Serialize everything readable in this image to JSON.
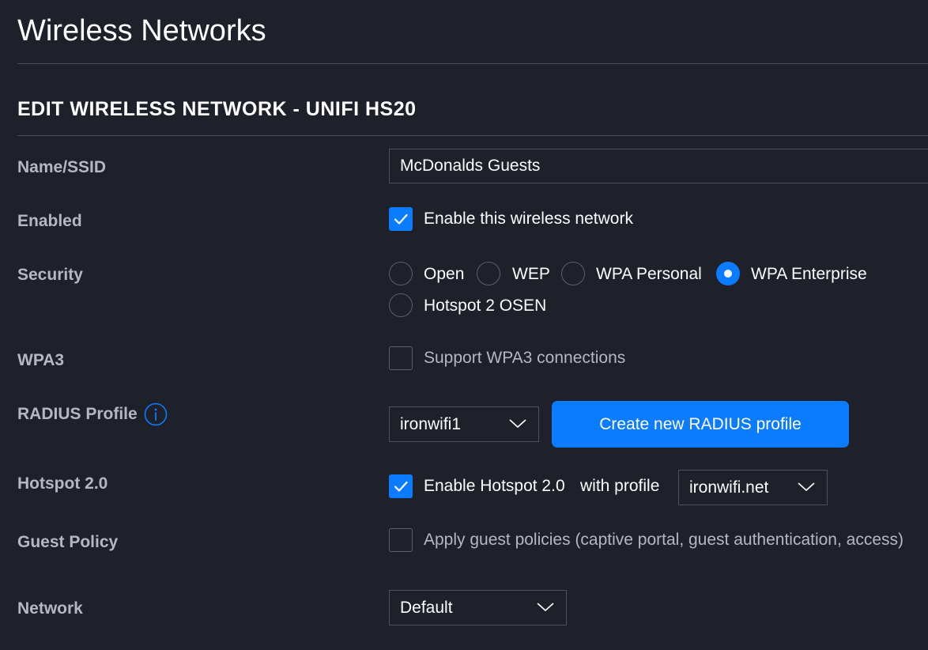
{
  "page": {
    "title": "Wireless Networks"
  },
  "section": {
    "title": "EDIT WIRELESS NETWORK - UNIFI HS20"
  },
  "colors": {
    "background": "#1e202a",
    "accent": "#0b7bff",
    "label": "#b5b8c0",
    "border": "#4f525c"
  },
  "form": {
    "name": {
      "label": "Name/SSID",
      "value": "McDonalds Guests"
    },
    "enabled": {
      "label": "Enabled",
      "checkbox_label": "Enable this wireless network",
      "checked": true
    },
    "security": {
      "label": "Security",
      "options": [
        {
          "label": "Open",
          "selected": false
        },
        {
          "label": "WEP",
          "selected": false
        },
        {
          "label": "WPA Personal",
          "selected": false
        },
        {
          "label": "WPA Enterprise",
          "selected": true
        },
        {
          "label": "Hotspot 2 OSEN",
          "selected": false
        }
      ]
    },
    "wpa3": {
      "label": "WPA3",
      "checkbox_label": "Support WPA3 connections",
      "checked": false
    },
    "radius_profile": {
      "label": "RADIUS Profile",
      "info_icon": "info-icon",
      "selected": "ironwifi1",
      "create_button": "Create new RADIUS profile"
    },
    "hotspot20": {
      "label": "Hotspot 2.0",
      "checkbox_label": "Enable Hotspot 2.0",
      "checked": true,
      "with_profile_label": "with profile",
      "profile_selected": "ironwifi.net"
    },
    "guest_policy": {
      "label": "Guest Policy",
      "checkbox_label": "Apply guest policies (captive portal, guest authentication, access)",
      "checked": false
    },
    "network": {
      "label": "Network",
      "selected": "Default"
    }
  }
}
